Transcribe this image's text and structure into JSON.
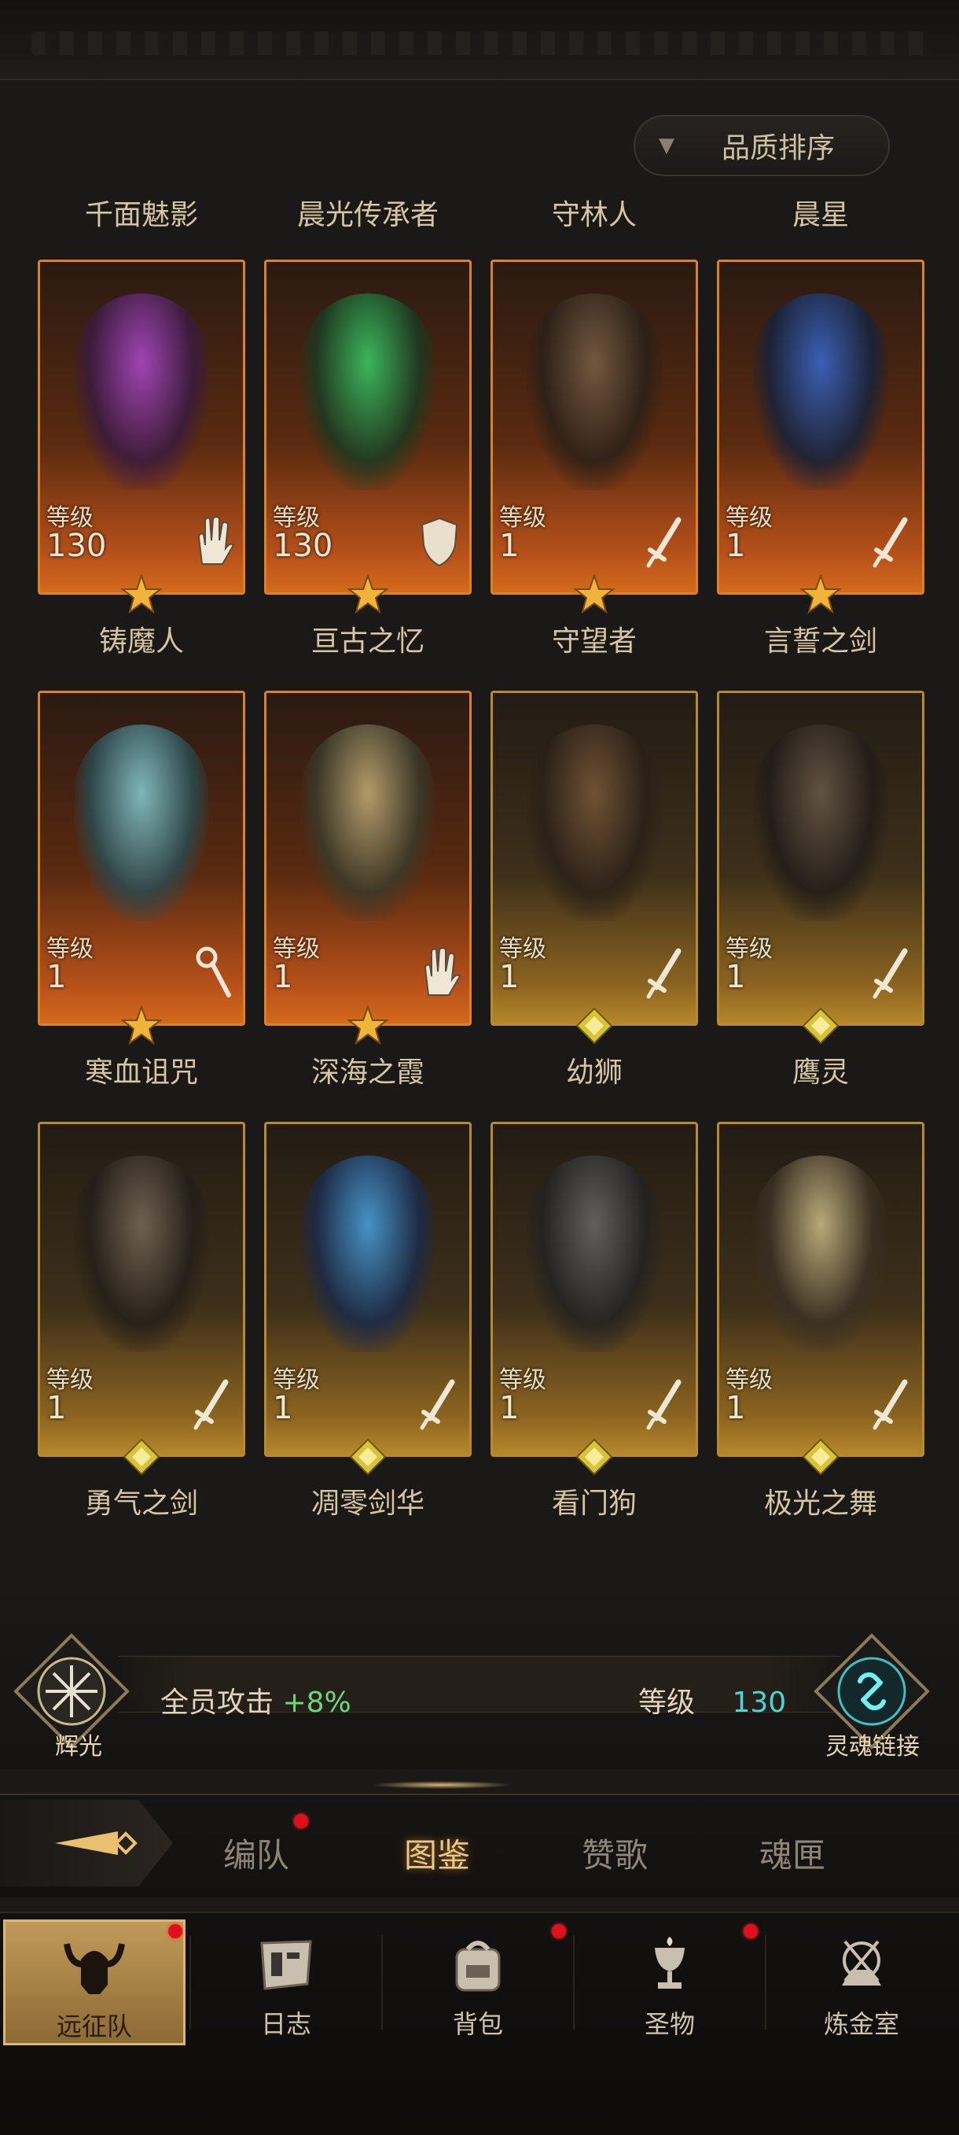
{
  "sort": {
    "label": "品质排序",
    "arrow_icon": "triangle-down-icon"
  },
  "heroes_row_labels": [
    "千面魅影",
    "晨光传承者",
    "守林人",
    "晨星"
  ],
  "heroes": [
    {
      "name": "铸魔人",
      "level_label": "等级",
      "level": "130",
      "class_icon": "palm-icon",
      "rarity": "orange",
      "c1": "#b04ad0",
      "c2": "#3a1a40"
    },
    {
      "name": "亘古之忆",
      "level_label": "等级",
      "level": "130",
      "class_icon": "shield-icon",
      "rarity": "orange",
      "c1": "#3ad06a",
      "c2": "#1a3a22"
    },
    {
      "name": "守望者",
      "level_label": "等级",
      "level": "1",
      "class_icon": "sword-icon",
      "rarity": "orange",
      "c1": "#7a6248",
      "c2": "#2a2018"
    },
    {
      "name": "言誓之剑",
      "level_label": "等级",
      "level": "1",
      "class_icon": "sword-icon",
      "rarity": "orange",
      "c1": "#3a6ad0",
      "c2": "#16223a"
    },
    {
      "name": "寒血诅咒",
      "level_label": "等级",
      "level": "1",
      "class_icon": "staff-icon",
      "rarity": "orange",
      "c1": "#8ad0d6",
      "c2": "#2a4a50"
    },
    {
      "name": "深海之霞",
      "level_label": "等级",
      "level": "1",
      "class_icon": "palm-icon",
      "rarity": "orange",
      "c1": "#c6b07a",
      "c2": "#3a3a2a"
    },
    {
      "name": "幼狮",
      "level_label": "等级",
      "level": "1",
      "class_icon": "sword-icon",
      "rarity": "gold",
      "c1": "#7a5a3a",
      "c2": "#2a2018"
    },
    {
      "name": "鹰灵",
      "level_label": "等级",
      "level": "1",
      "class_icon": "sword-icon",
      "rarity": "gold",
      "c1": "#6a5a4a",
      "c2": "#221c18"
    },
    {
      "name": "勇气之剑",
      "level_label": "等级",
      "level": "1",
      "class_icon": "sword-icon",
      "rarity": "gold",
      "c1": "#7a6a5a",
      "c2": "#241e18"
    },
    {
      "name": "凋零剑华",
      "level_label": "等级",
      "level": "1",
      "class_icon": "sword-icon",
      "rarity": "gold",
      "c1": "#4aa6e6",
      "c2": "#1a2a4a"
    },
    {
      "name": "看门狗",
      "level_label": "等级",
      "level": "1",
      "class_icon": "sword-icon",
      "rarity": "gold",
      "c1": "#6a6a6a",
      "c2": "#222222"
    },
    {
      "name": "极光之舞",
      "level_label": "等级",
      "level": "1",
      "class_icon": "sword-icon",
      "rarity": "gold",
      "c1": "#d0c08a",
      "c2": "#3a3024"
    }
  ],
  "bonus": {
    "left_emblem_label": "辉光",
    "left_emblem_icon": "radiance-emblem-icon",
    "attack_text": "全员攻击",
    "attack_value": "+8%",
    "level_label": "等级",
    "level_value": "130",
    "right_emblem_label": "灵魂链接",
    "right_emblem_icon": "soul-link-icon"
  },
  "sub_tabs": [
    {
      "label": "编队",
      "active": false,
      "dot": true
    },
    {
      "label": "图鉴",
      "active": true,
      "dot": false
    },
    {
      "label": "赞歌",
      "active": false,
      "dot": false
    },
    {
      "label": "魂匣",
      "active": false,
      "dot": false
    }
  ],
  "nav": [
    {
      "label": "远征队",
      "icon": "horned-helmet-icon",
      "active": true,
      "dot": true
    },
    {
      "label": "日志",
      "icon": "scroll-icon",
      "active": false,
      "dot": false
    },
    {
      "label": "背包",
      "icon": "backpack-icon",
      "active": false,
      "dot": true
    },
    {
      "label": "圣物",
      "icon": "chalice-icon",
      "active": false,
      "dot": true
    },
    {
      "label": "炼金室",
      "icon": "alchemy-icon",
      "active": false,
      "dot": false
    }
  ],
  "colors": {
    "accent": "#e8c58a",
    "cyan": "#4fd3d6",
    "green": "#6fd67a",
    "notify": "#e0101a"
  }
}
